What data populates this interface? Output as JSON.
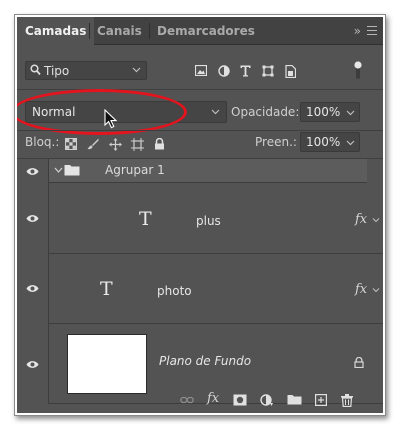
{
  "tabs": [
    {
      "label": "Camadas",
      "active": true
    },
    {
      "label": "Canais",
      "active": false
    },
    {
      "label": "Demarcadores",
      "active": false
    }
  ],
  "tab_more": "»",
  "filter": {
    "label": "Tipo",
    "icons": [
      "image-filter-icon",
      "adjustment-filter-icon",
      "type-filter-icon",
      "shape-filter-icon",
      "smart-object-filter-icon"
    ]
  },
  "blend": {
    "mode": "Normal",
    "opacity_label": "Opacidade:",
    "opacity_value": "100%"
  },
  "lock": {
    "label": "Bloq.:",
    "fill_label": "Preen.:",
    "fill_value": "100%"
  },
  "layers": [
    {
      "type": "group",
      "name": "Agrupar 1"
    },
    {
      "type": "text",
      "name": "plus",
      "glyph": "T",
      "fx": "fx"
    },
    {
      "type": "text",
      "name": "photo",
      "glyph": "T",
      "fx": "fx"
    },
    {
      "type": "background",
      "name": "Plano de Fundo"
    }
  ],
  "bottom_fx": "fx",
  "colors": {
    "panel": "#535353",
    "tabbar": "#424242",
    "annotation": "#e3141e"
  }
}
